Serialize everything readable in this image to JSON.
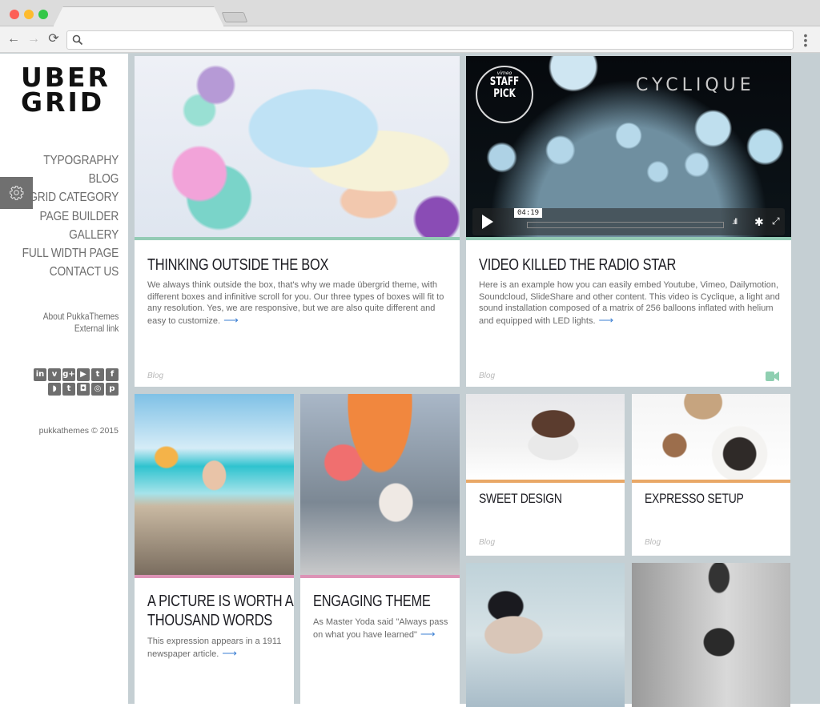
{
  "browser": {
    "address_value": "",
    "icons": {
      "back": "←",
      "forward": "→",
      "reload": "⟳",
      "menu": "⋮"
    }
  },
  "sidebar": {
    "logo_line1": "UBER",
    "logo_line2": "GRID",
    "nav": [
      {
        "label": "TYPOGRAPHY"
      },
      {
        "label": "BLOG"
      },
      {
        "label": "GRID CATEGORY"
      },
      {
        "label": "PAGE BUILDER"
      },
      {
        "label": "GALLERY"
      },
      {
        "label": "FULL WIDTH PAGE"
      },
      {
        "label": "CONTACT US"
      }
    ],
    "extra_links": [
      {
        "label": "About PukkaThemes"
      },
      {
        "label": "External link"
      }
    ],
    "social_row1": [
      {
        "name": "linkedin",
        "glyph": "in"
      },
      {
        "name": "vimeo",
        "glyph": "v"
      },
      {
        "name": "google-plus",
        "glyph": "g+"
      },
      {
        "name": "youtube",
        "glyph": "▶"
      },
      {
        "name": "twitter",
        "glyph": "t"
      },
      {
        "name": "facebook",
        "glyph": "f"
      }
    ],
    "social_row2": [
      {
        "name": "rss",
        "glyph": "◗"
      },
      {
        "name": "tumblr",
        "glyph": "t"
      },
      {
        "name": "instagram",
        "glyph": "◘"
      },
      {
        "name": "picasa",
        "glyph": "◎"
      },
      {
        "name": "pinterest",
        "glyph": "p"
      }
    ],
    "copyright": "pukkathemes © 2015"
  },
  "cards": {
    "outside_box": {
      "title": "THINKING OUTSIDE THE BOX",
      "text": "We always think outside the box, that's why we made übergrid theme, with different boxes and infinitive scroll for you. Our three types of boxes will fit to any resolution. Yes, we are responsive, but we are also quite different and easy to customize.",
      "arrow": "⟶",
      "category": "Blog",
      "accent": "#94cbb5"
    },
    "video": {
      "title": "VIDEO KILLED THE RADIO STAR",
      "text": "Here is an example how you can easily embed Youtube, Vimeo, Dailymotion, Soundcloud, SlideShare and other content. This video is Cyclique, a light and sound installation composed of a matrix of 256 balloons inflated with helium and equipped with LED lights.",
      "arrow": "⟶",
      "category": "Blog",
      "accent": "#94cbb5",
      "player": {
        "badge_brand": "vimeo",
        "badge_line1": "STAFF",
        "badge_line2": "PICK",
        "overlay_title": "CYCLIQUE",
        "time": "04:19",
        "volume_glyph": ".ıll",
        "settings_glyph": "✱",
        "fullscreen_glyph": "⤢"
      }
    },
    "picture": {
      "title_line1": "A PICTURE IS WORTH A",
      "title_line2": "THOUSAND WORDS",
      "text": "This expression appears in a 1911 newspaper article.",
      "arrow": "⟶",
      "accent": "#dd93b6"
    },
    "engaging": {
      "title": "ENGAGING THEME",
      "text": "As Master Yoda said \"Always pass on what you have learned\"",
      "arrow": "⟶",
      "accent": "#dd93b6"
    },
    "sweet": {
      "title": "SWEET DESIGN",
      "category": "Blog",
      "accent": "#e9a867"
    },
    "espresso": {
      "title": "EXPRESSO SETUP",
      "category": "Blog",
      "accent": "#e9a867"
    }
  }
}
